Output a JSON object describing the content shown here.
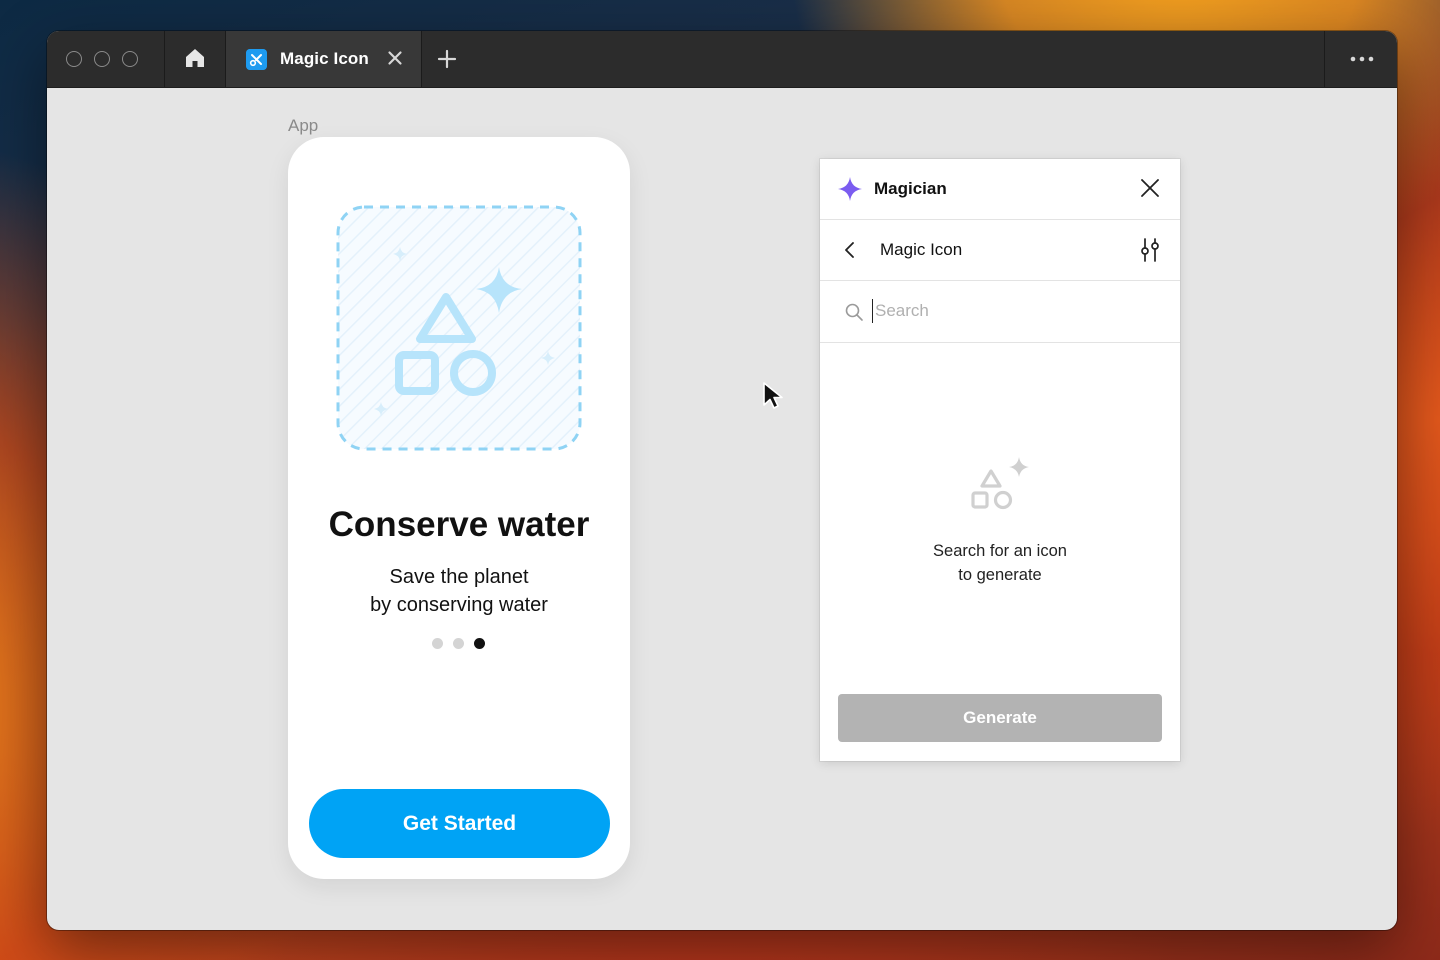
{
  "window": {
    "tab": {
      "label": "Magic Icon",
      "icon": "magic-icon-app-icon"
    },
    "icons": {
      "home": "home-icon",
      "close_tab": "close-icon",
      "new_tab": "plus-icon",
      "more": "more-icon"
    }
  },
  "canvas": {
    "frame_label": "App"
  },
  "phone": {
    "title": "Conserve water",
    "subtitle_line1": "Save the planet",
    "subtitle_line2": "by conserving water",
    "pagination": {
      "total": 3,
      "active": 3
    },
    "cta_label": "Get Started",
    "accent_color": "#00a3f5"
  },
  "panel": {
    "title": "Magician",
    "nav_title": "Magic Icon",
    "search": {
      "placeholder": "Search",
      "value": ""
    },
    "empty_line1": "Search for an icon",
    "empty_line2": "to generate",
    "generate_label": "Generate",
    "accent_color": "#7b5cf0"
  }
}
